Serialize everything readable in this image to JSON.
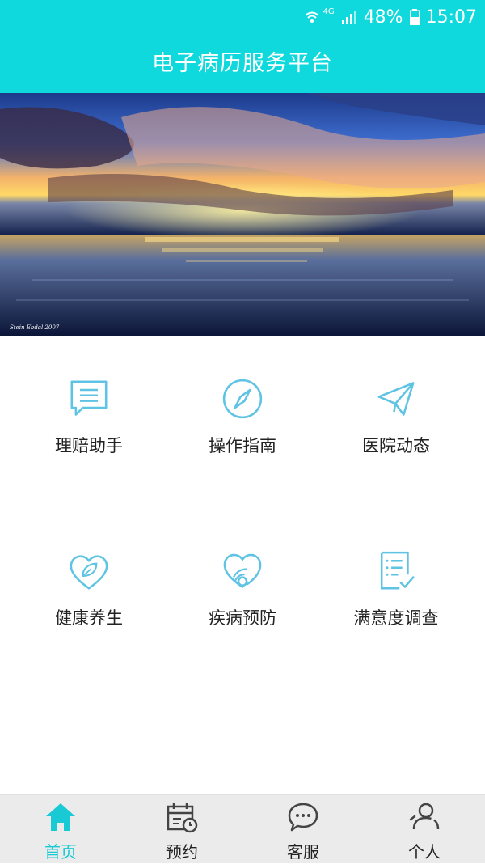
{
  "status_bar": {
    "network": "4G",
    "battery": "48%",
    "time": "15:07"
  },
  "header": {
    "title": "电子病历服务平台"
  },
  "banner": {
    "signature": "Stein Ebdal 2007"
  },
  "menu": [
    {
      "label": "理赔助手",
      "icon": "message-icon"
    },
    {
      "label": "操作指南",
      "icon": "compass-icon"
    },
    {
      "label": "医院动态",
      "icon": "paper-plane-icon"
    },
    {
      "label": "健康养生",
      "icon": "heart-leaf-icon"
    },
    {
      "label": "疾病预防",
      "icon": "heart-stethoscope-icon"
    },
    {
      "label": "满意度调查",
      "icon": "checklist-icon"
    }
  ],
  "tabs": [
    {
      "label": "首页",
      "icon": "home-icon",
      "active": true
    },
    {
      "label": "预约",
      "icon": "calendar-clock-icon",
      "active": false
    },
    {
      "label": "客服",
      "icon": "chat-icon",
      "active": false
    },
    {
      "label": "个人",
      "icon": "user-icon",
      "active": false
    }
  ],
  "colors": {
    "accent": "#0fd9dc",
    "icon_stroke": "#5fc3e4",
    "active_tab": "#19c9d4",
    "tabbar_bg": "#ebebeb"
  }
}
